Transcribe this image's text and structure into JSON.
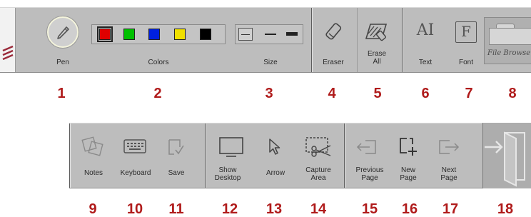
{
  "toolbar_top": {
    "logo": "logo-icon",
    "tools": [
      {
        "id": "pen",
        "label": "Pen",
        "icon": "pencil-icon"
      },
      {
        "id": "colors",
        "label": "Colors"
      },
      {
        "id": "size",
        "label": "Size"
      },
      {
        "id": "eraser",
        "label": "Eraser",
        "icon": "eraser-icon"
      },
      {
        "id": "erase_all",
        "label": "Erase\nAll",
        "icon": "erase-all-icon"
      },
      {
        "id": "text",
        "label": "Text",
        "glyph": "AI",
        "icon": "text-icon"
      },
      {
        "id": "font",
        "label": "Font",
        "glyph": "F",
        "icon": "font-icon"
      },
      {
        "id": "file_browser",
        "label": "File Browser",
        "icon": "folder-icon"
      }
    ],
    "colors": [
      "#e00000",
      "#00c000",
      "#0020e0",
      "#f0e000",
      "#000000"
    ]
  },
  "toolbar_bottom": {
    "tools": [
      {
        "id": "notes",
        "label": "Notes",
        "icon": "notes-icon"
      },
      {
        "id": "keyboard",
        "label": "Keyboard",
        "icon": "keyboard-icon"
      },
      {
        "id": "save",
        "label": "Save",
        "icon": "save-icon"
      },
      {
        "id": "show_desktop",
        "label": "Show\nDesktop",
        "icon": "monitor-icon"
      },
      {
        "id": "arrow",
        "label": "Arrow",
        "icon": "cursor-arrow-icon"
      },
      {
        "id": "capture_area",
        "label": "Capture\nArea",
        "icon": "scissors-icon"
      },
      {
        "id": "previous_page",
        "label": "Previous\nPage",
        "icon": "previous-page-icon"
      },
      {
        "id": "new_page",
        "label": "New\nPage",
        "icon": "new-page-icon"
      },
      {
        "id": "next_page",
        "label": "Next\nPage",
        "icon": "next-page-icon"
      },
      {
        "id": "exit",
        "icon": "exit-door-icon"
      }
    ]
  },
  "numbers": {
    "top": [
      "1",
      "2",
      "3",
      "4",
      "5",
      "6",
      "7",
      "8"
    ],
    "bottom": [
      "9",
      "10",
      "11",
      "12",
      "13",
      "14",
      "15",
      "16",
      "17",
      "18"
    ]
  }
}
